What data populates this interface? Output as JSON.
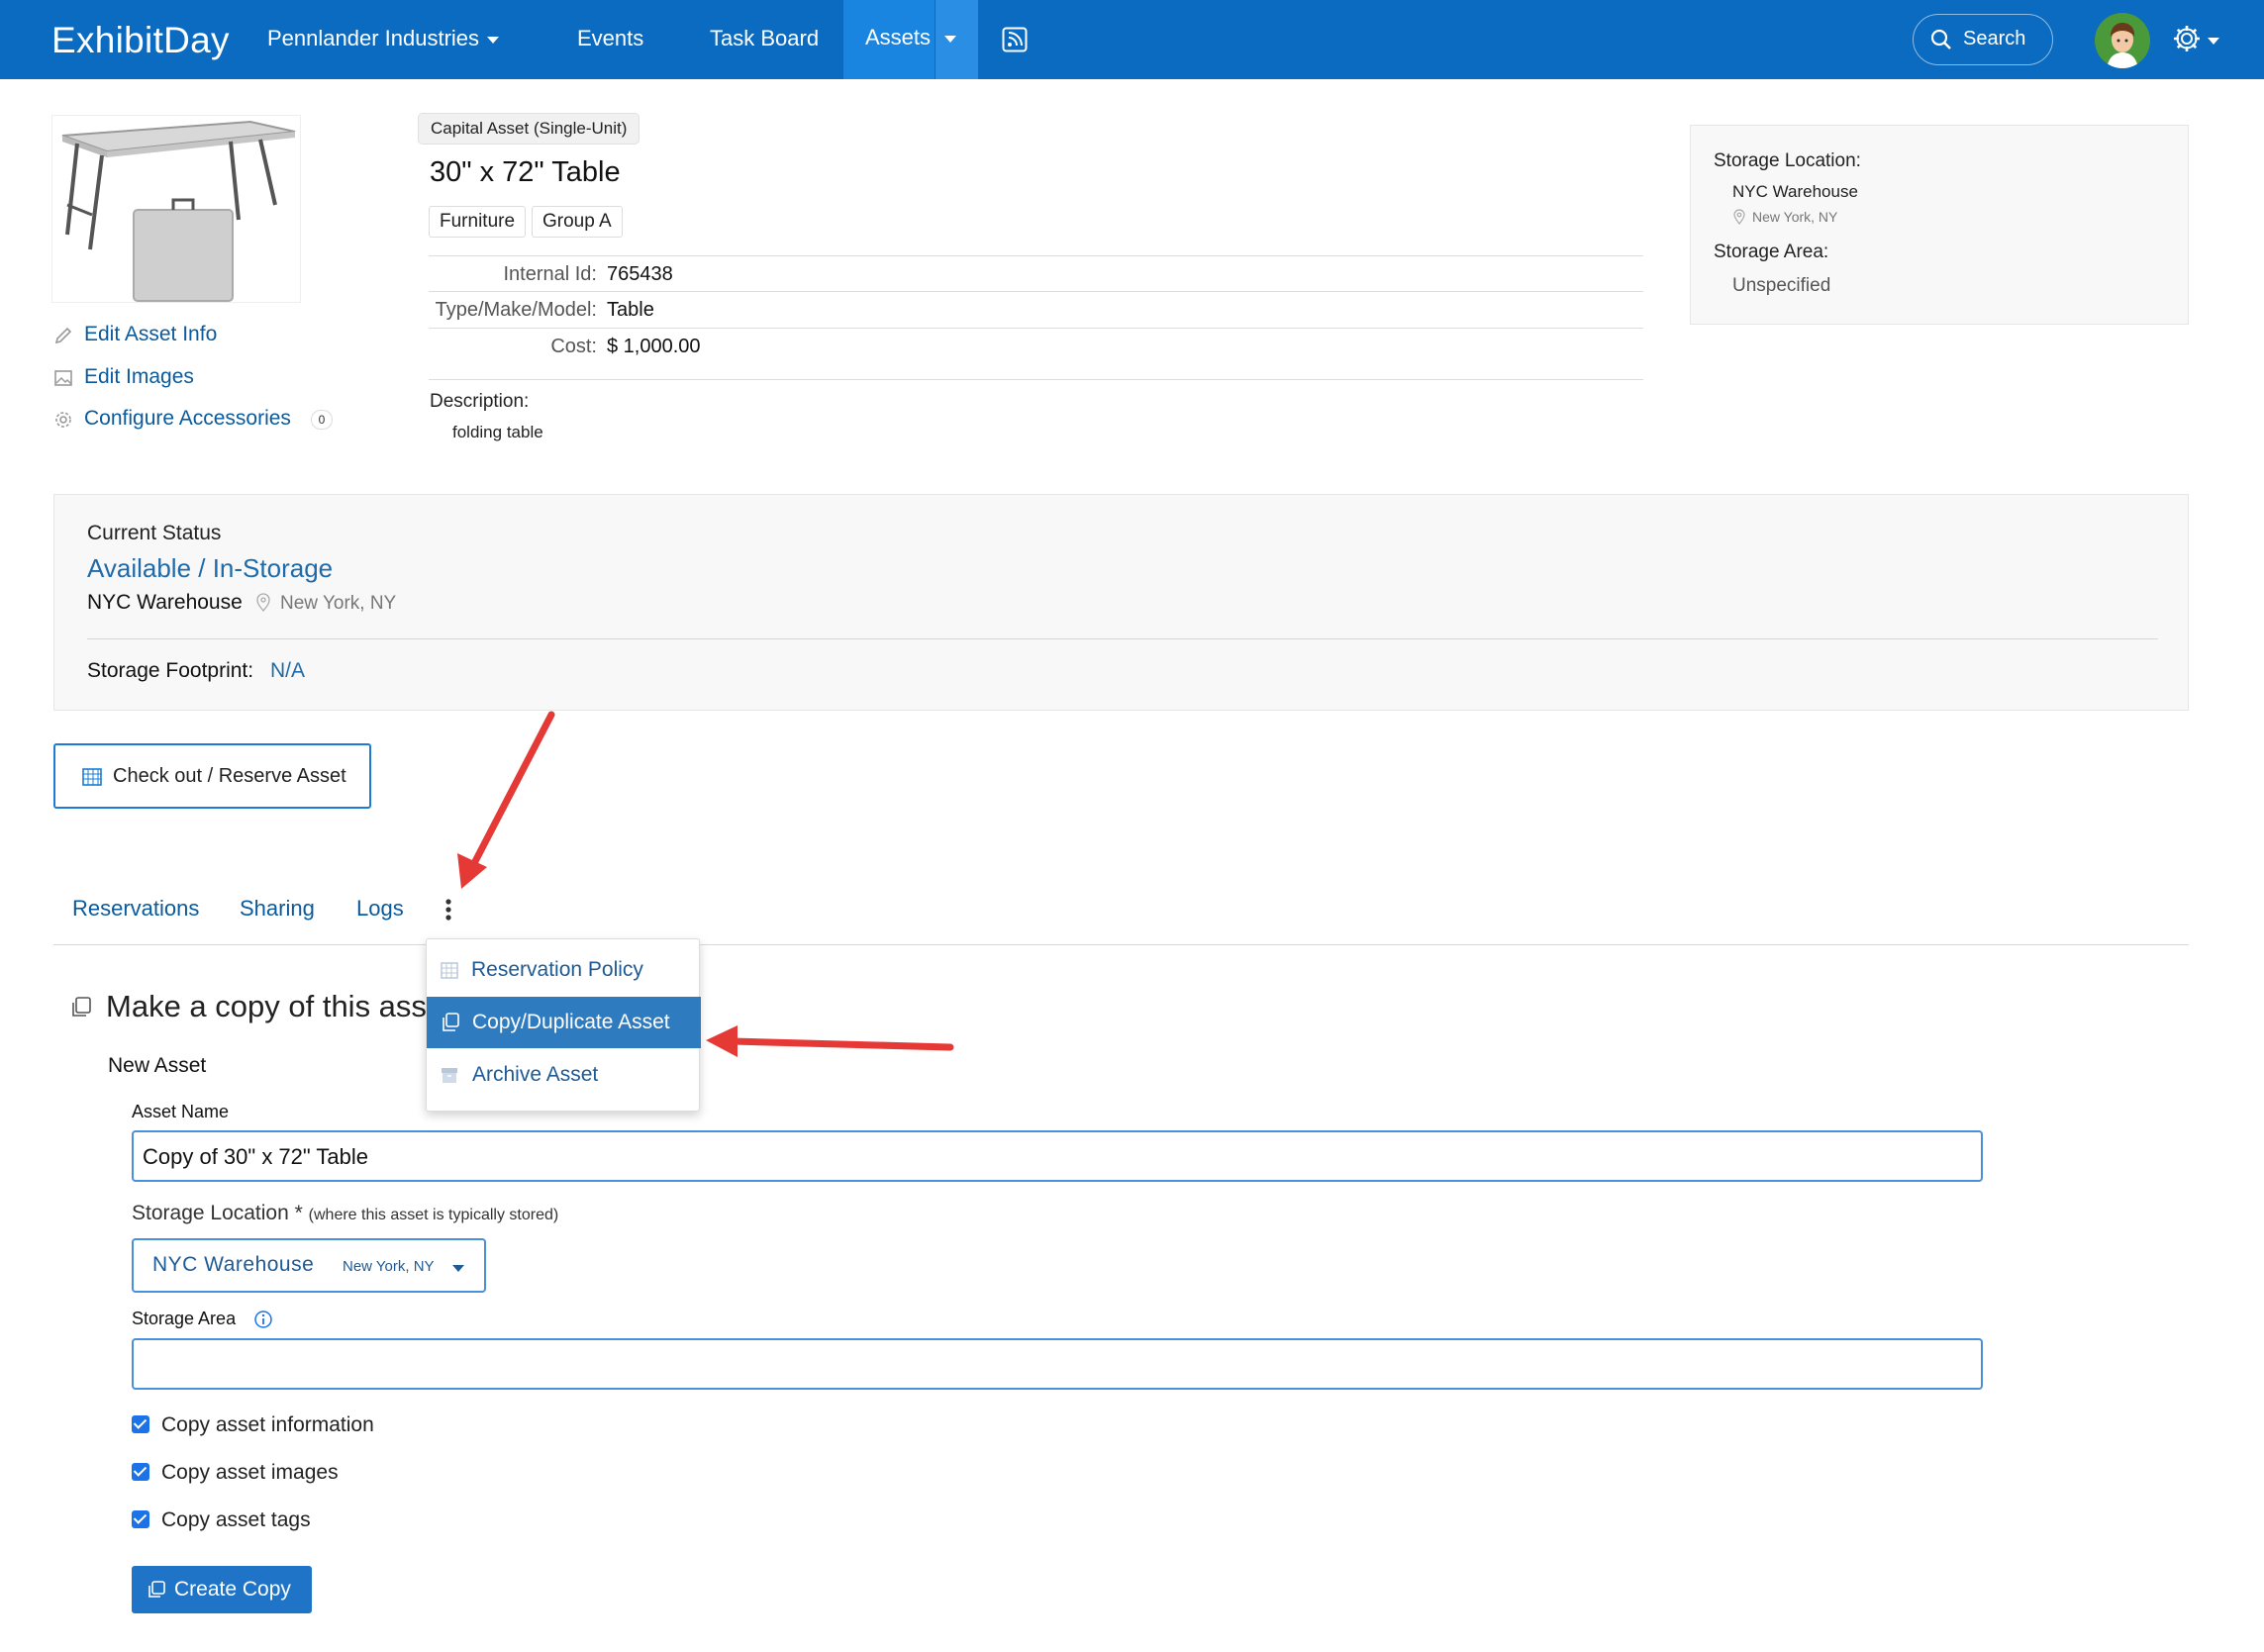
{
  "nav": {
    "logo": "ExhibitDay",
    "org": "Pennlander Industries",
    "events": "Events",
    "task_board": "Task Board",
    "assets": "Assets",
    "search": "Search",
    "brand_color": "#0a6bc0"
  },
  "asset": {
    "type_badge": "Capital Asset (Single-Unit)",
    "title": "30\" x 72\" Table",
    "tags": [
      "Furniture",
      "Group A"
    ],
    "internal_id_label": "Internal Id:",
    "internal_id": "765438",
    "model_label": "Type/Make/Model:",
    "model": "Table",
    "cost_label": "Cost:",
    "cost": "$ 1,000.00",
    "description_label": "Description:",
    "description": "folding table"
  },
  "actions": {
    "edit_info": "Edit Asset Info",
    "edit_images": "Edit Images",
    "configure_accessories": "Configure Accessories",
    "accessories_count": "0"
  },
  "storage": {
    "location_label": "Storage Location:",
    "location": "NYC Warehouse",
    "location_city": "New York, NY",
    "area_label": "Storage Area:",
    "area": "Unspecified"
  },
  "status": {
    "heading": "Current Status",
    "value": "Available / In-Storage",
    "location": "NYC Warehouse",
    "city": "New York, NY",
    "footprint_label": "Storage Footprint:",
    "footprint": "N/A"
  },
  "checkout_button": "Check out / Reserve Asset",
  "tabs": [
    "Reservations",
    "Sharing",
    "Logs"
  ],
  "menu": {
    "items": [
      "Reservation Policy",
      "Copy/Duplicate Asset",
      "Archive Asset"
    ],
    "selected": "Copy/Duplicate Asset"
  },
  "copy_form": {
    "heading": "Make a copy of this asse",
    "subheading": "New Asset",
    "name_label": "Asset Name",
    "name_value": "Copy of 30\" x 72\" Table",
    "location_label": "Storage Location",
    "location_required": "*",
    "location_hint": "(where this asset is typically stored)",
    "location_value": "NYC Warehouse",
    "location_city": "New York, NY",
    "area_label": "Storage Area",
    "area_value": "",
    "checkboxes": [
      "Copy asset information",
      "Copy asset images",
      "Copy asset tags"
    ],
    "create_button": "Create Copy"
  }
}
